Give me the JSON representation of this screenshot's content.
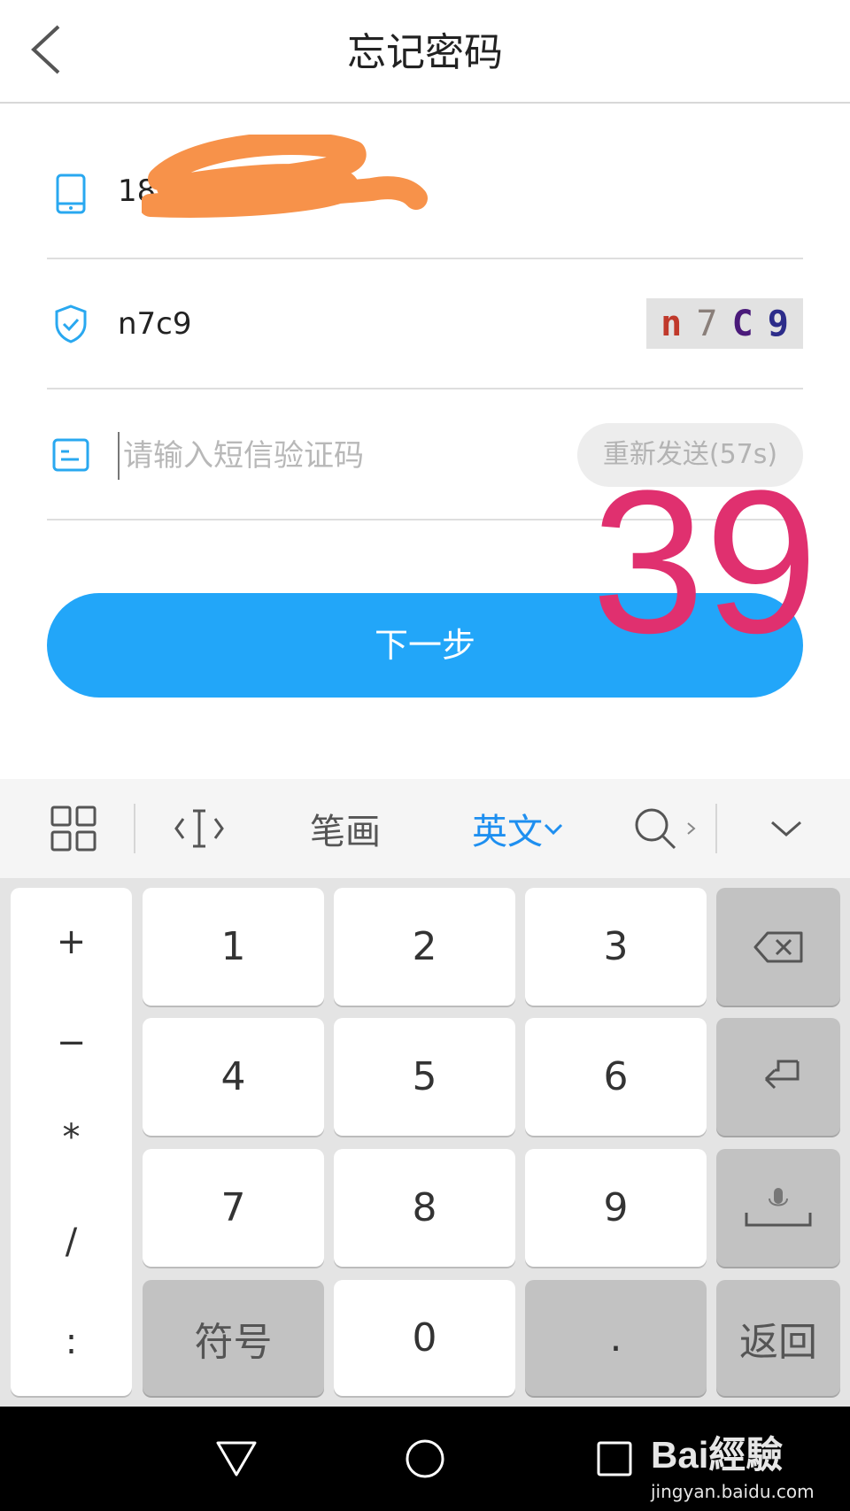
{
  "header": {
    "title": "忘记密码"
  },
  "form": {
    "phone_prefix": "18",
    "captcha_value": "n7c9",
    "captcha_chars": [
      {
        "ch": "n",
        "color": "#c0392b"
      },
      {
        "ch": "7",
        "color": "#8a7f7a"
      },
      {
        "ch": "C",
        "color": "#4a1a7a"
      },
      {
        "ch": "9",
        "color": "#2c2c8a"
      }
    ],
    "sms_placeholder": "请输入短信验证码",
    "resend_label": "重新发送(57s)",
    "next_label": "下一步"
  },
  "overlay_number": "39",
  "keyboard": {
    "toolbar": {
      "stroke": "笔画",
      "english": "英文"
    },
    "symbols": [
      "+",
      "−",
      "*",
      "/",
      ":"
    ],
    "digits": [
      "1",
      "2",
      "3",
      "4",
      "5",
      "6",
      "7",
      "8",
      "9"
    ],
    "symbol_key": "符号",
    "zero_key": "0",
    "dot_key": ".",
    "back_key": "返回"
  },
  "watermark": {
    "brand": "Bai經驗",
    "url": "jingyan.baidu.com"
  }
}
